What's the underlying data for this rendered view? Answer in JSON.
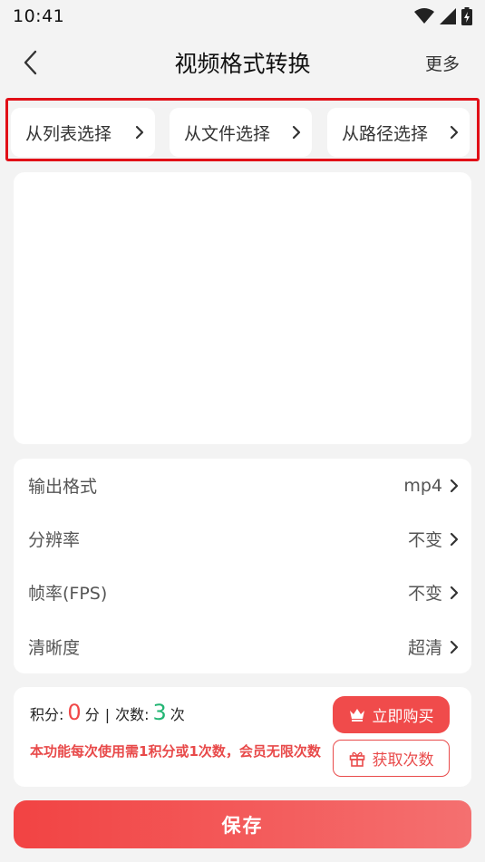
{
  "status_bar": {
    "time": "10:41"
  },
  "header": {
    "title": "视频格式转换",
    "more_label": "更多"
  },
  "source_buttons": [
    {
      "label": "从列表选择"
    },
    {
      "label": "从文件选择"
    },
    {
      "label": "从路径选择"
    }
  ],
  "settings": [
    {
      "label": "输出格式",
      "value": "mp4"
    },
    {
      "label": "分辨率",
      "value": "不变"
    },
    {
      "label": "帧率(FPS)",
      "value": "不变"
    },
    {
      "label": "清晰度",
      "value": "超清"
    }
  ],
  "points": {
    "points_label": "积分:",
    "points_value": "0",
    "points_unit": "分",
    "separator": "|",
    "count_label": "次数:",
    "count_value": "3",
    "count_unit": "次",
    "note": "本功能每次使用需1积分或1次数，会员无限次数",
    "buy_label": "立即购买",
    "get_label": "获取次数"
  },
  "save_label": "保存",
  "colors": {
    "accent": "#f04b4b",
    "highlight_border": "#e10f17",
    "count_green": "#22b573",
    "background": "#f3f3f3"
  }
}
